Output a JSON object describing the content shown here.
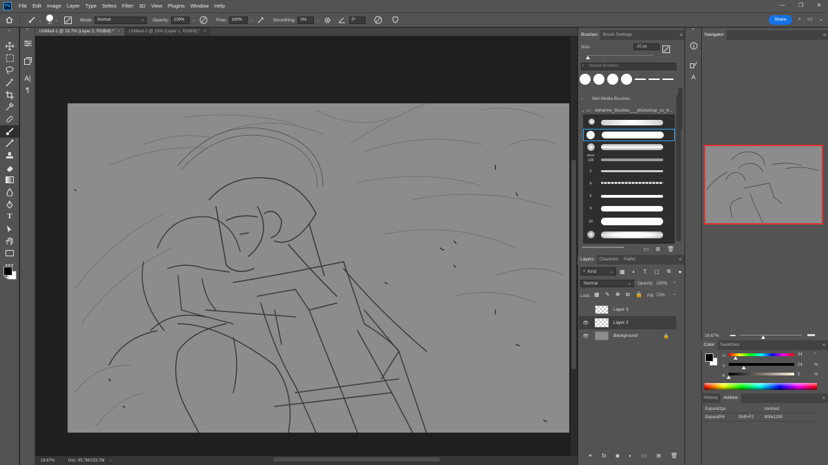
{
  "app": {
    "logo": "Ps"
  },
  "menu": [
    "File",
    "Edit",
    "Image",
    "Layer",
    "Type",
    "Select",
    "Filter",
    "3D",
    "View",
    "Plugins",
    "Window",
    "Help"
  ],
  "options": {
    "brush_size_value": "20",
    "mode_label": "Mode:",
    "mode_value": "Normal",
    "opacity_label": "Opacity:",
    "opacity_value": "100%",
    "flow_label": "Flow:",
    "flow_value": "100%",
    "smoothing_label": "Smoothing:",
    "smoothing_value": "0%",
    "angle_value": "0°",
    "share_label": "Share"
  },
  "tabs": [
    {
      "label": "Untitled-1 @ 16.7% (Layer 2, RGB/8) *",
      "active": true
    },
    {
      "label": "Untitled-2 @ 15% (Layer 1, RGB/8) *",
      "active": false
    }
  ],
  "status": {
    "zoom": "16.67%",
    "doc": "Doc: 95.7M/233.7M"
  },
  "brushes_panel": {
    "tabs": [
      "Brushes",
      "Brush Settings"
    ],
    "size_label": "Size:",
    "size_value": "20 px",
    "search_placeholder": "Search Brushes",
    "folders": [
      "Wet Media Brushes",
      "deharme_brushes___photoshop_cc_b..."
    ],
    "brush_numbers": [
      "",
      "",
      "",
      "195",
      "2",
      "4",
      "5",
      "9",
      "22",
      ""
    ],
    "brush_badge": "9819"
  },
  "layers_panel": {
    "tabs": [
      "Layers",
      "Channels",
      "Paths"
    ],
    "kind_label": "Kind",
    "blend_mode": "Normal",
    "opacity_label": "Opacity:",
    "opacity_value": "100%",
    "lock_label": "Lock:",
    "fill_label": "Fill:",
    "fill_value": "72%",
    "layers": [
      {
        "name": "Layer 3",
        "visible": false,
        "selected": false
      },
      {
        "name": "Layer 2",
        "visible": true,
        "selected": true
      },
      {
        "name": "Background",
        "visible": true,
        "selected": false,
        "locked": true
      }
    ]
  },
  "navigator": {
    "tab": "Navigator",
    "zoom": "16.67%"
  },
  "color_panel": {
    "tabs": [
      "Color",
      "Swatches"
    ],
    "h_label": "H",
    "h_value": "34",
    "h_unit": "°",
    "s_label": "S",
    "s_value": "24",
    "s_unit": "%",
    "b_label": "B",
    "b_value": "0",
    "b_unit": "%",
    "foreground": "#000000",
    "background": "#ffffff"
  },
  "actions_panel": {
    "tabs": [
      "History",
      "Actions"
    ],
    "rows": [
      {
        "name": "Expand2px",
        "key": "",
        "detail": "contract"
      },
      {
        "name": "ExpandFill",
        "key": "Shift+F2",
        "detail": "800x1250"
      }
    ]
  },
  "colors": {
    "accent": "#1473e6",
    "selection": "#31a8ff",
    "nav_frame": "#e0312e"
  }
}
